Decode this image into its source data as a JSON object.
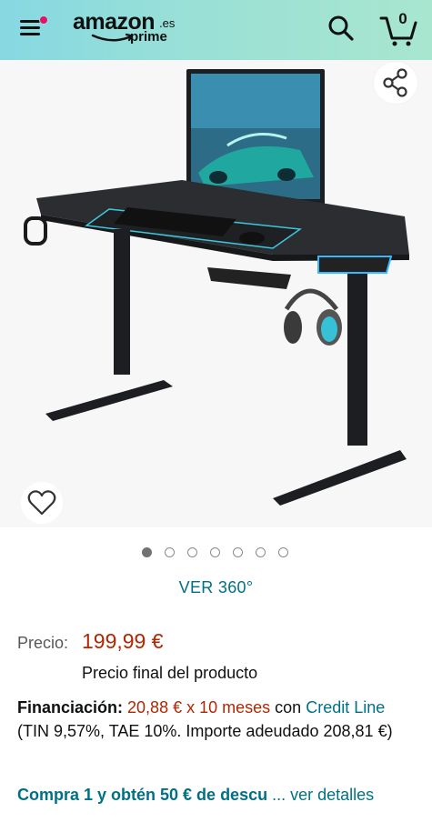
{
  "header": {
    "logo_text": "amazon",
    "logo_suffix": ".es",
    "logo_sub": "prime",
    "cart_count": "0",
    "icons": [
      "menu-icon",
      "search-icon",
      "cart-icon"
    ],
    "colors": {
      "gradient_start": "#86d8e2",
      "gradient_end": "#a8e6cf",
      "notification_dot": "#e3116c"
    }
  },
  "gallery": {
    "image_subject": "gaming-desk-with-monitor-keyboard-headphones",
    "icons": [
      "share-icon",
      "heart-icon"
    ],
    "dot_count": 7,
    "active_dot": 0,
    "view_360_label": "VER 360°"
  },
  "pricing": {
    "label": "Precio:",
    "value": "199,99 €",
    "note": "Precio final del producto"
  },
  "financing": {
    "label": "Financiación:",
    "installments": "20,88 € x 10 meses",
    "connector": "con",
    "credit_link": "Credit Line",
    "details": "(TIN 9,57%, TAE 10%. Importe adeudado 208,81 €)"
  },
  "promo": {
    "text": "Compra 1 y obtén 50 € de descu",
    "details_link": "... ver detalles"
  },
  "colors": {
    "link": "#007185",
    "price": "#b12704",
    "muted": "#565959"
  }
}
